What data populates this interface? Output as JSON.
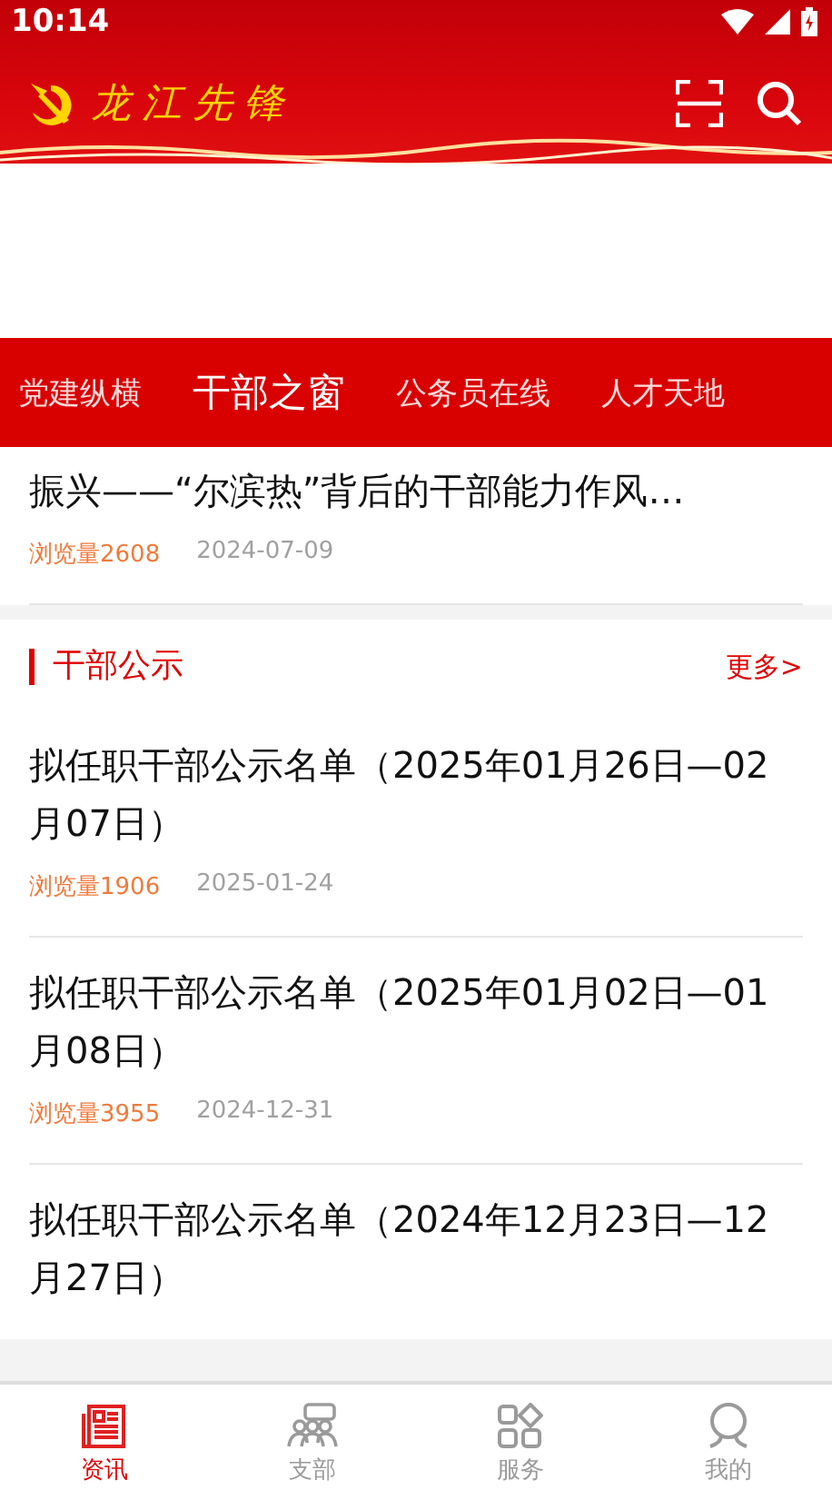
{
  "status_bar": {
    "time": "10:14"
  },
  "header": {
    "logo_text": "龙江先锋"
  },
  "tabs": [
    {
      "label": "党建纵横",
      "selected": false
    },
    {
      "label": "干部之窗",
      "selected": true
    },
    {
      "label": "公务员在线",
      "selected": false
    },
    {
      "label": "人才天地",
      "selected": false
    }
  ],
  "top_article": {
    "title": "振兴——“尔滨热”背后的干部能力作风…",
    "views": "浏览量2608",
    "date": "2024-07-09"
  },
  "section": {
    "title": "干部公示",
    "more": "更多>"
  },
  "articles": [
    {
      "title": "拟任职干部公示名单（2025年01月26日—02月07日）",
      "views": "浏览量1906",
      "date": "2025-01-24"
    },
    {
      "title": "拟任职干部公示名单（2025年01月02日—01月08日）",
      "views": "浏览量3955",
      "date": "2024-12-31"
    },
    {
      "title": "拟任职干部公示名单（2024年12月23日—12月27日）"
    }
  ],
  "bottom_nav": [
    {
      "label": "资讯",
      "kind": "news",
      "selected": true
    },
    {
      "label": "支部",
      "kind": "branch",
      "selected": false
    },
    {
      "label": "服务",
      "kind": "service",
      "selected": false
    },
    {
      "label": "我的",
      "kind": "me",
      "selected": false
    }
  ]
}
